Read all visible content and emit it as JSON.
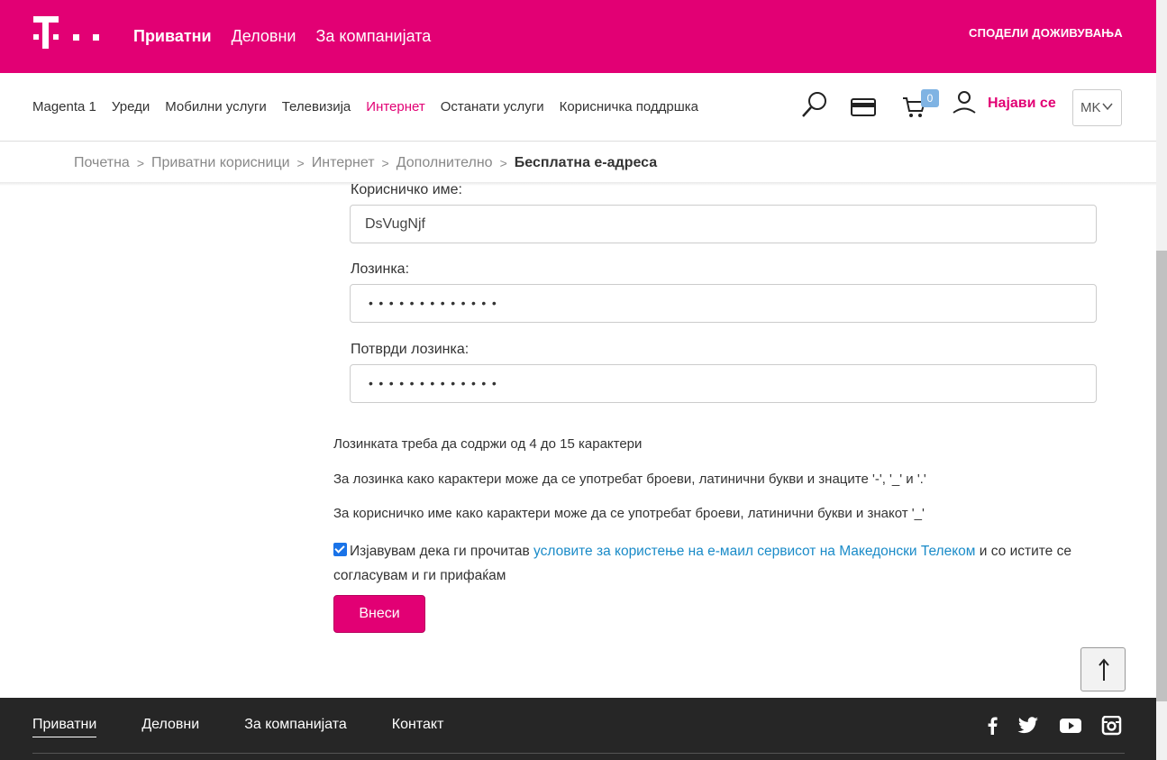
{
  "header": {
    "nav": [
      "Приватни",
      "Деловни",
      "За компанијата"
    ],
    "share": "СПОДЕЛИ ДОЖИВУВАЊА"
  },
  "menu": {
    "items": [
      "Magenta 1",
      "Уреди",
      "Мобилни услуги",
      "Телевизија",
      "Интернет",
      "Останати услуги",
      "Корисничка поддршка"
    ],
    "cart_count": "0",
    "login": "Најави се",
    "language": "MK"
  },
  "breadcrumb": {
    "items": [
      "Почетна",
      "Приватни корисници",
      "Интернет",
      "Дополнително"
    ],
    "current": "Бесплатна е-адреса"
  },
  "form": {
    "username_label": "Корисничко име:",
    "username_value": "DsVugNjf",
    "password_label": "Лозинка:",
    "password_value": "•••••••••••••",
    "confirm_label": "Потврди лозинка:",
    "confirm_value": "•••••••••••••",
    "note1": "Лозинката треба да содржи од 4 до 15 карактери",
    "note2": "За лозинка како карактери може да се употребат броеви, латинични букви и знаците '-', '_' и '.'",
    "note3": "За корисничко име како карактери може да се употребат броеви, латинични букви и знакот '_'",
    "agree_prefix": "Изјавувам дека ги прочитав ",
    "agree_link": "условите за користење на е-маил сервисот на Македонски Телеком",
    "agree_suffix": " и со истите се согласувам и ги прифаќам",
    "agree_checked": true,
    "submit": "Внеси"
  },
  "footer": {
    "nav": [
      "Приватни",
      "Деловни",
      "За компанијата",
      "Контакт"
    ]
  },
  "colors": {
    "brand": "#e20074",
    "link": "#1a8bc8",
    "footer_bg": "#262626"
  },
  "icons": [
    "search-icon",
    "card-icon",
    "cart-icon",
    "user-icon",
    "chevron-down-icon",
    "arrow-up-icon",
    "facebook-icon",
    "twitter-icon",
    "youtube-icon",
    "instagram-icon"
  ]
}
